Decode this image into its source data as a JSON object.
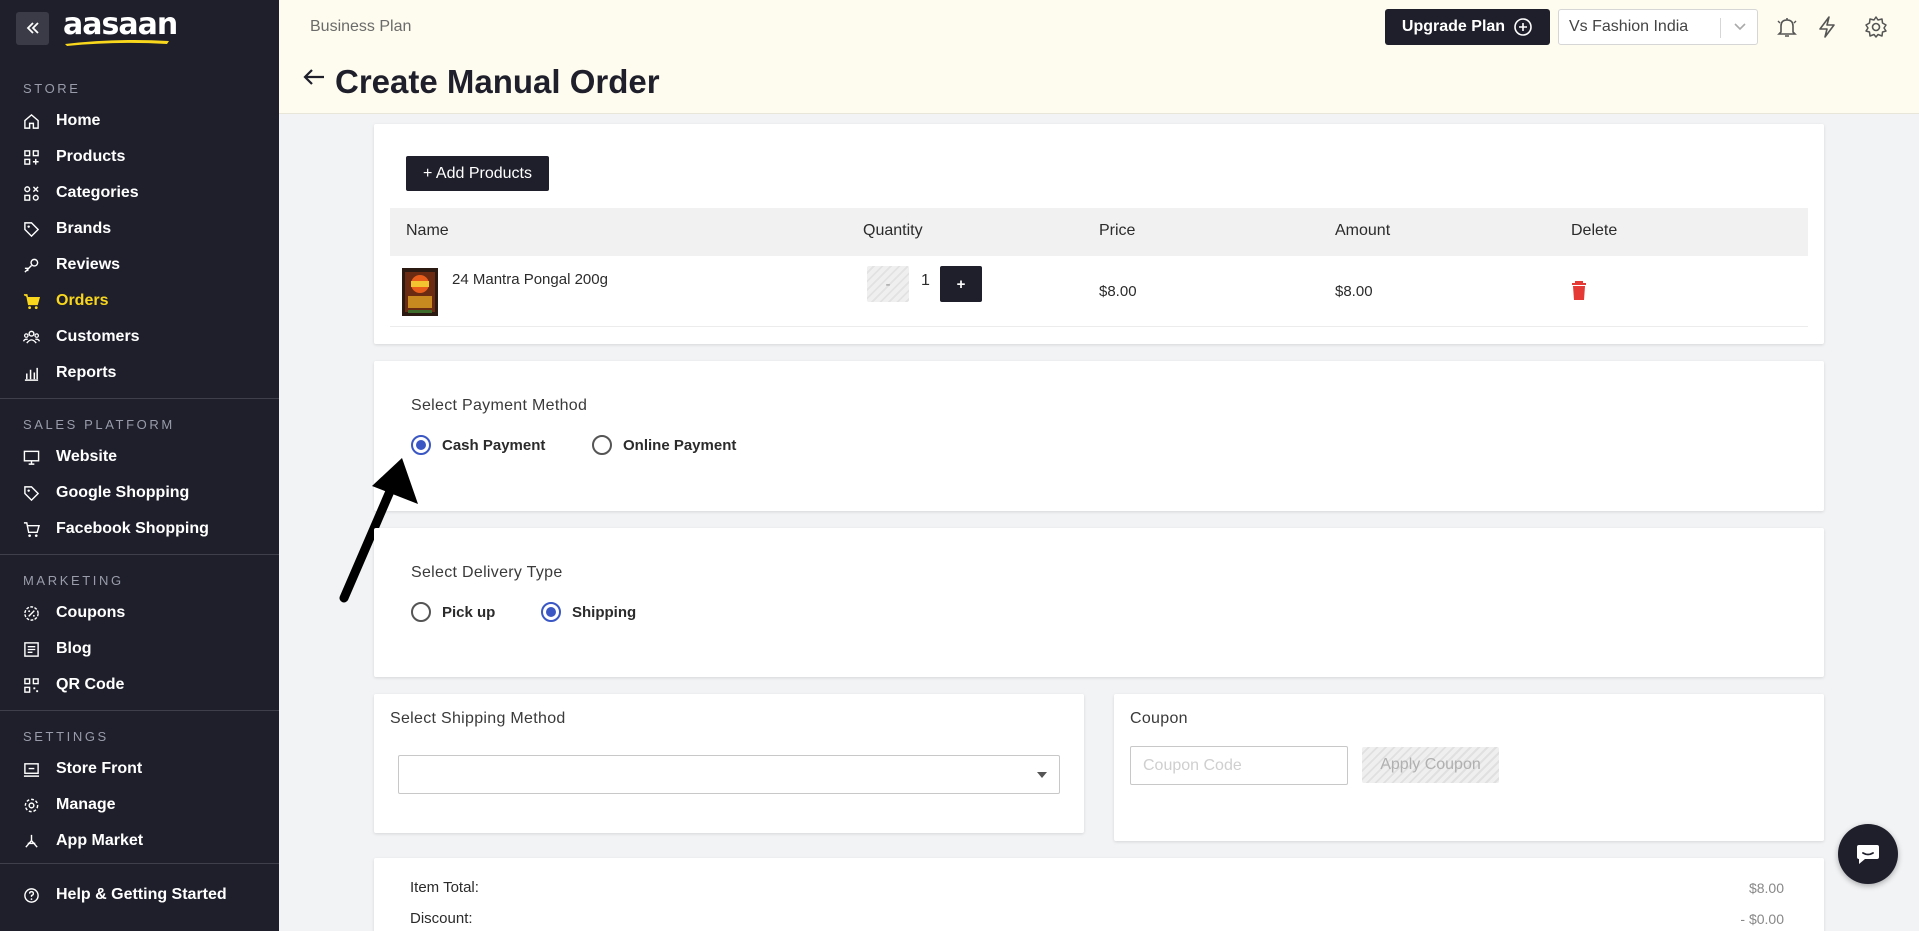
{
  "brand": {
    "logo": "aasaan",
    "accent": "#f9d71c",
    "sidebar_bg": "#1e1f2b"
  },
  "sidebar": {
    "sections": [
      {
        "title": "STORE",
        "items": [
          {
            "label": "Home",
            "icon": "home-icon"
          },
          {
            "label": "Products",
            "icon": "products-icon"
          },
          {
            "label": "Categories",
            "icon": "categories-icon"
          },
          {
            "label": "Brands",
            "icon": "tag-icon"
          },
          {
            "label": "Reviews",
            "icon": "reviews-icon"
          },
          {
            "label": "Orders",
            "icon": "cart-icon",
            "active": true
          },
          {
            "label": "Customers",
            "icon": "users-icon"
          },
          {
            "label": "Reports",
            "icon": "chart-icon"
          }
        ]
      },
      {
        "title": "SALES PLATFORM",
        "items": [
          {
            "label": "Website",
            "icon": "monitor-icon"
          },
          {
            "label": "Google Shopping",
            "icon": "tag-icon"
          },
          {
            "label": "Facebook Shopping",
            "icon": "cart-icon"
          }
        ]
      },
      {
        "title": "MARKETING",
        "items": [
          {
            "label": "Coupons",
            "icon": "coupon-icon"
          },
          {
            "label": "Blog",
            "icon": "blog-icon"
          },
          {
            "label": "QR Code",
            "icon": "qr-icon"
          }
        ]
      },
      {
        "title": "SETTINGS",
        "items": [
          {
            "label": "Store Front",
            "icon": "storefront-icon"
          },
          {
            "label": "Manage",
            "icon": "gear-icon"
          },
          {
            "label": "App Market",
            "icon": "app-market-icon"
          }
        ]
      }
    ],
    "help": "Help & Getting Started"
  },
  "header": {
    "plan": "Business Plan",
    "title": "Create Manual Order",
    "upgrade": "Upgrade Plan",
    "store": "Vs Fashion India"
  },
  "products": {
    "add_button": "+ Add Products",
    "columns": [
      "Name",
      "Quantity",
      "Price",
      "Amount",
      "Delete"
    ],
    "rows": [
      {
        "name": "24 Mantra Pongal 200g",
        "quantity": "1",
        "minus": "-",
        "plus": "+",
        "price": "$8.00",
        "amount": "$8.00"
      }
    ]
  },
  "payment": {
    "label": "Select Payment Method",
    "options": [
      "Cash Payment",
      "Online Payment"
    ],
    "selected": "Cash Payment"
  },
  "delivery": {
    "label": "Select Delivery Type",
    "options": [
      "Pick up",
      "Shipping"
    ],
    "selected": "Shipping"
  },
  "shipping": {
    "label": "Select Shipping Method",
    "value": ""
  },
  "coupon": {
    "label": "Coupon",
    "placeholder": "Coupon Code",
    "apply": "Apply Coupon"
  },
  "summary": {
    "item_total_label": "Item Total:",
    "item_total": "$8.00",
    "discount_label": "Discount:",
    "discount": "- $0.00"
  }
}
